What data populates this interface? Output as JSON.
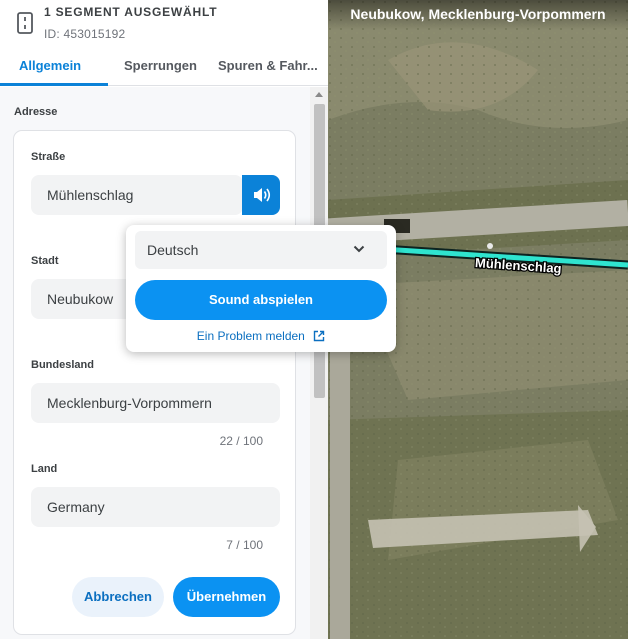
{
  "header": {
    "title": "1 SEGMENT AUSGEWÄHLT",
    "id_text": "ID: 453015192",
    "icon": "road-segment-icon"
  },
  "tabs": [
    {
      "label": "Allgemein",
      "active": true
    },
    {
      "label": "Sperrungen",
      "active": false
    },
    {
      "label": "Spuren & Fahr...",
      "active": false
    }
  ],
  "address": {
    "section_label": "Adresse",
    "fields": [
      {
        "label": "Straße",
        "value": "Mühlenschlag"
      },
      {
        "label": "Stadt",
        "value": "Neubukow"
      },
      {
        "label": "Bundesland",
        "value": "Mecklenburg-Vorpommern",
        "counter": "22 / 100"
      },
      {
        "label": "Land",
        "value": "Germany",
        "counter": "7 / 100"
      }
    ],
    "sound_icon": "speaker-icon",
    "cancel_label": "Abbrechen",
    "apply_label": "Übernehmen"
  },
  "map": {
    "title": "Neubukow, Mecklenburg-Vorpommern",
    "street_label": "Mühlenschlag"
  },
  "popup": {
    "language": "Deutsch",
    "play_label": "Sound abspielen",
    "report_label": "Ein Problem melden",
    "report_icon": "external-link-icon"
  },
  "colors": {
    "accent": "#0b82d8",
    "button_primary": "#0b92f2",
    "segment_highlight": "#2fe4cf"
  }
}
